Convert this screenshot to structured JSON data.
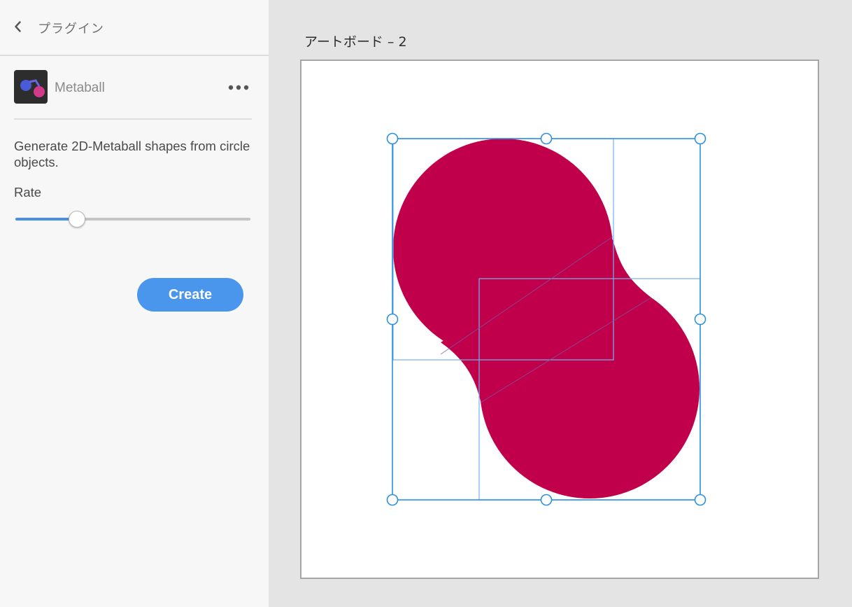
{
  "panel": {
    "title": "プラグイン",
    "plugin_name": "Metaball",
    "description": "Generate 2D-Metaball shapes from circle objects.",
    "rate_label": "Rate",
    "rate_value": 0.26,
    "create_label": "Create"
  },
  "canvas": {
    "artboard_label": "アートボード – 2",
    "shape_color": "#c0004a",
    "selection_color": "#2d8fe0",
    "guide_color": "#6fb3ee"
  },
  "icons": {
    "back": "chevron-left-icon",
    "more": "more-horizontal-icon",
    "logo": "metaball-plugin-logo"
  }
}
